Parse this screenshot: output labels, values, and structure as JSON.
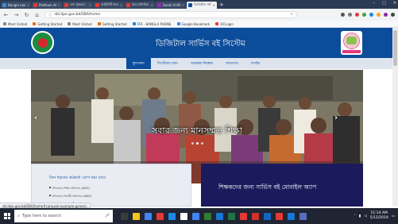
{
  "browser": {
    "tabs": [
      {
        "label": "Bangla news",
        "active": false,
        "favicon_color": "#3b8ed0"
      },
      {
        "label": "Prothom Alo",
        "active": false,
        "favicon_color": "#e53935"
      },
      {
        "label": "এক সুস্থতার",
        "active": false,
        "favicon_color": "#e53935"
      },
      {
        "label": "আইসিটি বাংলা",
        "active": false,
        "favicon_color": "#e53935"
      },
      {
        "label": "কবে মাধ্যমিক",
        "active": false,
        "favicon_color": "#e53935"
      },
      {
        "label": "Sarah Al-Wa",
        "active": false,
        "favicon_color": "#9c27b0"
      },
      {
        "label": "ডিজিটাল সার্ভি",
        "active": true,
        "favicon_color": "#0c4d9b"
      }
    ],
    "new_tab_symbol": "+",
    "window_controls": [
      "–",
      "□",
      "✕"
    ],
    "url": "sbl.dpe.gov.bd/SBA/home",
    "bookmarks": [
      {
        "label": "Most Visited",
        "color": "#888888"
      },
      {
        "label": "Getting Started",
        "color": "#e8710a"
      },
      {
        "label": "Most Visited",
        "color": "#888888"
      },
      {
        "label": "Getting Started",
        "color": "#e8710a"
      },
      {
        "label": "FFA - BANGLA PHONE",
        "color": "#1e88e5"
      },
      {
        "label": "Google Bookmark",
        "color": "#4285f4"
      },
      {
        "label": "OCLogin",
        "color": "#e53935"
      }
    ]
  },
  "site": {
    "title": "ডিজিটাল সার্ভিস বই সিস্টেম",
    "brand_color": "#0c4d9b",
    "nav": [
      {
        "label": "মূলপাতা",
        "active": true
      },
      {
        "label": "সিস্টেমের ধরন",
        "active": false
      },
      {
        "label": "অভ্যন্তর নিবন্ধন",
        "active": false
      },
      {
        "label": "আমাদের",
        "active": false
      },
      {
        "label": "লগইন",
        "active": false
      }
    ],
    "slider": {
      "caption": "সবার জন্য মানসম্মত শিক্ষা",
      "prev_symbol": "‹",
      "next_symbol": "›",
      "slide_count": 3,
      "active_slide": 1
    },
    "left_card": {
      "heading": "তিন ধরনের কর্মকর্তা যোগ করা যাবে",
      "items": [
        "উপজেলা শিক্ষা অফিসার (UEO)",
        "উপজেলা নির্বাহী অফিসার (UNO)",
        "উপজেলা প্রকৌশলী (PTI Engr)"
      ]
    },
    "right_card": {
      "heading": "শিক্ষকদের জন্য সার্ভিস বই মোবাইল অ্যাপ"
    }
  },
  "status_bar_text": "sbl.dpe.gov.bd/SBA/home#carousel-example-generic",
  "taskbar": {
    "search_placeholder": "Type here to search",
    "time": "11:14 AM",
    "date": "5/12/2019",
    "apps": [
      "#3c3c3c",
      "#f5c518",
      "#4285f4",
      "#e53935",
      "#1e88e5",
      "#ffffff",
      "#4285f4",
      "#2e7d32",
      "#1976d2",
      "#217346",
      "#e53935",
      "#d32f2f",
      "#1565c0",
      "#e53935",
      "#1976d2",
      "#5c6bc0"
    ]
  }
}
